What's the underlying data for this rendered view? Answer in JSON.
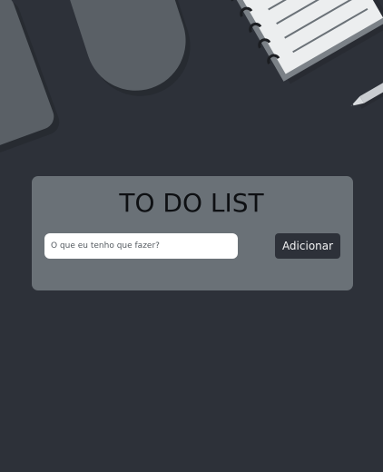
{
  "app": {
    "title": "TO DO LIST"
  },
  "form": {
    "input_value": "",
    "input_placeholder": "O que eu tenho que fazer?",
    "add_label": "Adicionar"
  },
  "tasks": [],
  "colors": {
    "background": "#2d3139",
    "card": "#6a7177",
    "button": "#2d3139",
    "title_text": "#0e1013"
  },
  "decorations": {
    "icons": [
      "phone-icon",
      "pill-shape-icon",
      "notebook-icon",
      "pen-icon"
    ]
  }
}
